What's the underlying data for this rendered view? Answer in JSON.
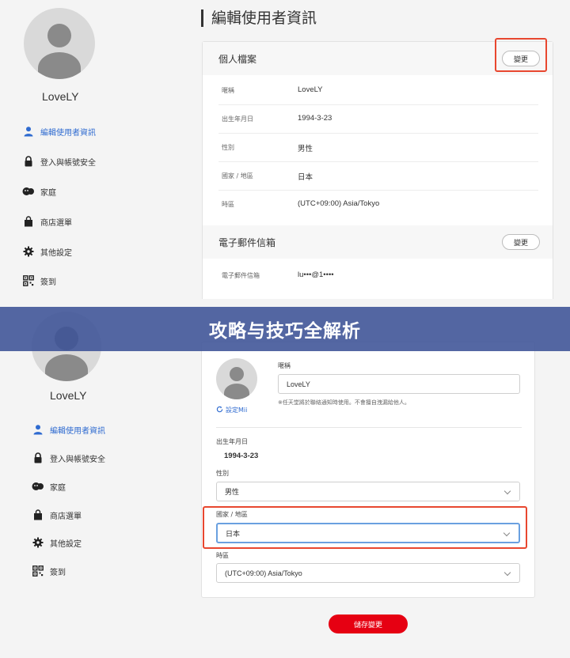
{
  "top": {
    "username": "LoveLY",
    "nav": [
      {
        "label": "編輯使用者資訊",
        "icon": "user-icon"
      },
      {
        "label": "登入與帳號安全",
        "icon": "lock-icon"
      },
      {
        "label": "家庭",
        "icon": "family-icon"
      },
      {
        "label": "商店選單",
        "icon": "shopping-bag-icon"
      },
      {
        "label": "其他設定",
        "icon": "gear-icon"
      },
      {
        "label": "簽到",
        "icon": "qr-code-icon"
      }
    ],
    "page_title": "編輯使用者資訊",
    "profile": {
      "title": "個人檔案",
      "change_label": "變更",
      "rows": [
        {
          "label": "暱稱",
          "value": "LoveLY"
        },
        {
          "label": "出生年月日",
          "value": "1994-3-23"
        },
        {
          "label": "性別",
          "value": "男性"
        },
        {
          "label": "國家 / 地區",
          "value": "日本"
        },
        {
          "label": "時區",
          "value": "(UTC+09:00) Asia/Tokyo"
        }
      ]
    },
    "email": {
      "title": "電子郵件信箱",
      "change_label": "變更",
      "row": {
        "label": "電子郵件信箱",
        "value": "lu•••@1••••"
      }
    }
  },
  "banner": {
    "text": "攻略与技巧全解析"
  },
  "bottom": {
    "username": "LoveLY",
    "nav": [
      {
        "label": "編輯使用者資訊"
      },
      {
        "label": "登入與帳號安全"
      },
      {
        "label": "家庭"
      },
      {
        "label": "商店選單"
      },
      {
        "label": "其他設定"
      },
      {
        "label": "簽到"
      }
    ],
    "form": {
      "nickname_label": "暱稱",
      "nickname_value": "LoveLY",
      "nickname_note": "※任天堂將於聯絡通知時使用。不會擅自洩漏給他人。",
      "set_mii": "設定Mii",
      "birth_label": "出生年月日",
      "birth_value": "1994-3-23",
      "gender_label": "性別",
      "gender_value": "男性",
      "country_label": "國家 / 地區",
      "country_value": "日本",
      "timezone_label": "時區",
      "timezone_value": "(UTC+09:00) Asia/Tokyo"
    },
    "save_label": "儲存變更"
  },
  "colors": {
    "accent_blue": "#2f6bd0",
    "highlight_red": "#e8472f",
    "save_red": "#e60012",
    "banner": "#3c5296"
  }
}
